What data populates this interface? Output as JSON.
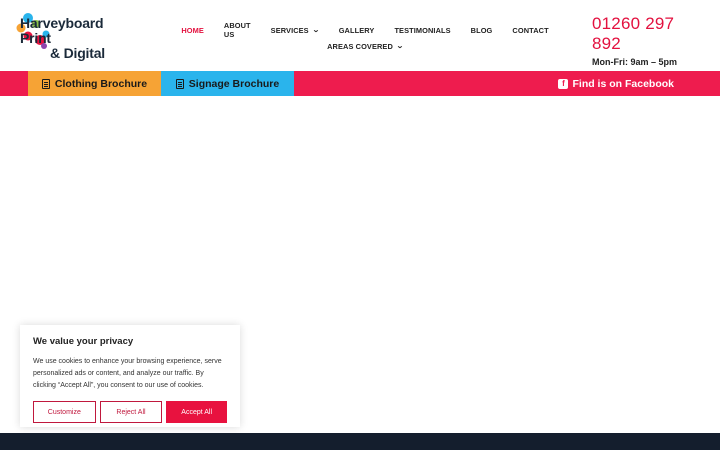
{
  "logo": {
    "line1": "Harveyboard Print",
    "line2": "& Digital",
    "icon": "colourful-blobs-logo-icon"
  },
  "nav": {
    "items": [
      {
        "label": "HOME",
        "active": true
      },
      {
        "label": "ABOUT US"
      },
      {
        "label": "SERVICES",
        "caret": true
      },
      {
        "label": "GALLERY"
      },
      {
        "label": "TESTIMONIALS"
      },
      {
        "label": "BLOG"
      },
      {
        "label": "CONTACT"
      }
    ],
    "row2": {
      "label": "AREAS COVERED",
      "caret": true
    }
  },
  "contact": {
    "phone": "01260 297 892",
    "hours": "Mon-Fri: 9am – 5pm"
  },
  "bar": {
    "clothing": "Clothing Brochure",
    "signage": "Signage Brochure",
    "facebook": "Find is on Facebook"
  },
  "cookie": {
    "title": "We value your privacy",
    "text": "We use cookies to enhance your browsing experience, serve personalized ads or content, and analyze our traffic. By clicking “Accept All”, you consent to our use of cookies.",
    "customize": "Customize",
    "reject": "Reject All",
    "accept": "Accept All"
  },
  "colors": {
    "accent": "#ee1c4e",
    "orange": "#f6a335",
    "blue": "#2ab4ec",
    "footer": "#141e2d"
  }
}
